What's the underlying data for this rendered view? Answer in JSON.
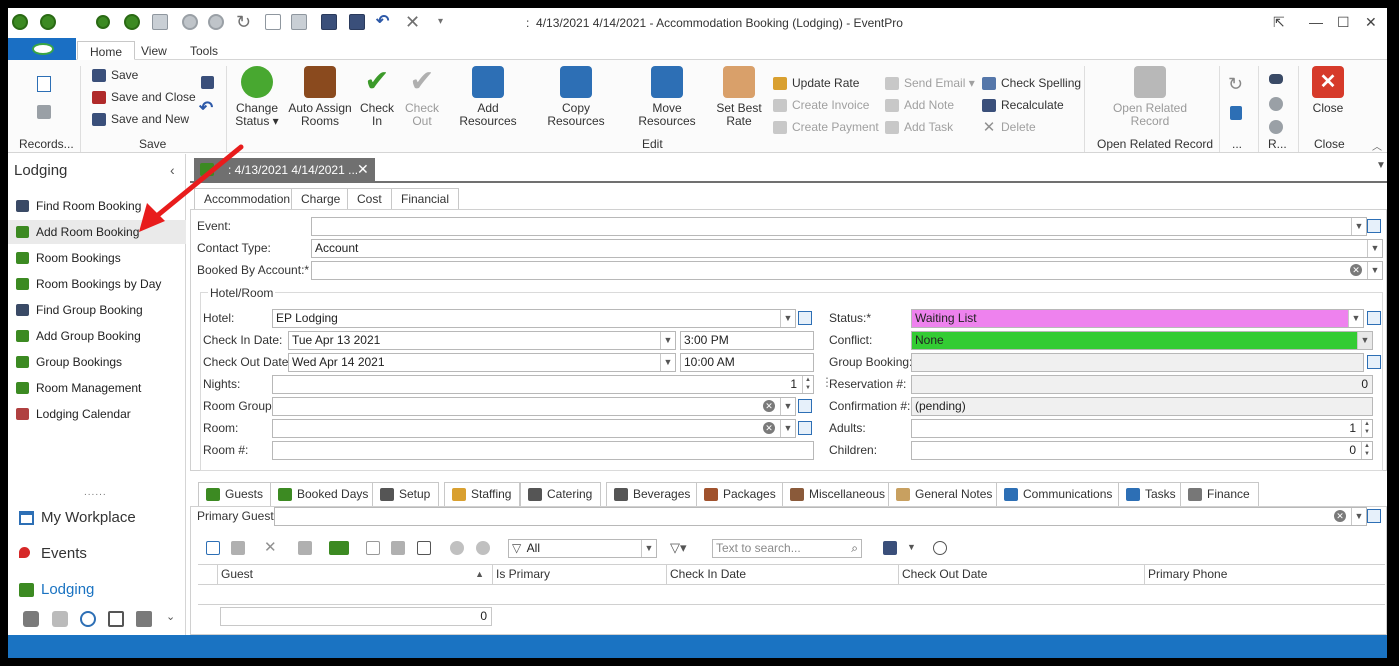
{
  "window": {
    "title": "4/13/2021 4/14/2021  - Accommodation Booking (Lodging) - EventPro",
    "title_prefix": ":"
  },
  "ribbon": {
    "tabs": [
      "Home",
      "View",
      "Tools"
    ],
    "active_tab": "Home",
    "groups": {
      "records": {
        "label": "Records..."
      },
      "save": {
        "label": "Save",
        "save": "Save",
        "save_and_close": "Save and Close",
        "save_and_new": "Save and New"
      },
      "edit": {
        "label": "Edit",
        "change_status": [
          "Change",
          "Status ▾"
        ],
        "auto_assign": [
          "Auto Assign",
          "Rooms"
        ],
        "check_in": [
          "Check",
          "In"
        ],
        "check_out": [
          "Check",
          "Out"
        ],
        "add_resources": "Add Resources",
        "copy_resources": "Copy Resources",
        "move_resources": "Move Resources",
        "set_best_rate": [
          "Set Best",
          "Rate"
        ],
        "update_rate": "Update Rate",
        "create_invoice": "Create Invoice",
        "create_payment": "Create Payment",
        "send_email": "Send Email",
        "add_note": "Add Note",
        "add_task": "Add Task",
        "check_spelling": "Check Spelling",
        "recalculate": "Recalculate",
        "delete": "Delete"
      },
      "open_related": {
        "label": "Open Related Record",
        "button": [
          "Open Related",
          "Record"
        ]
      },
      "misc": {
        "label": "..."
      },
      "r": {
        "label": "R..."
      },
      "close": {
        "label": "Close",
        "button": "Close"
      }
    }
  },
  "sidebar": {
    "title": "Lodging",
    "items": [
      {
        "label": "Find Room Booking",
        "icon": "binoculars-icon",
        "color": "#3a4a66"
      },
      {
        "label": "Add Room Booking",
        "icon": "add-booking-icon",
        "color": "#3c8a22"
      },
      {
        "label": "Room Bookings",
        "icon": "room-bookings-icon",
        "color": "#3c8a22"
      },
      {
        "label": "Room Bookings by Day",
        "icon": "room-bookings-day-icon",
        "color": "#3c8a22"
      },
      {
        "label": "Find Group Booking",
        "icon": "binoculars-icon",
        "color": "#3a4a66"
      },
      {
        "label": "Add Group Booking",
        "icon": "add-group-icon",
        "color": "#3c8a22"
      },
      {
        "label": "Group Bookings",
        "icon": "group-bookings-icon",
        "color": "#3c8a22"
      },
      {
        "label": "Room Management",
        "icon": "room-management-icon",
        "color": "#3c8a22"
      },
      {
        "label": "Lodging Calendar",
        "icon": "calendar-icon",
        "color": "#b04040"
      }
    ],
    "selected_index": 1,
    "grip": "......",
    "nav": [
      {
        "label": "My Workplace",
        "icon": "home-icon"
      },
      {
        "label": "Events",
        "icon": "pin-icon"
      },
      {
        "label": "Lodging",
        "icon": "lodging-icon"
      }
    ],
    "nav_selected": "Lodging"
  },
  "document_tab": {
    "label": ": 4/13/2021 4/14/2021 ..."
  },
  "form_tabs": [
    "Accommodation",
    "Charge",
    "Cost",
    "Financial"
  ],
  "form": {
    "event": {
      "label": "Event:",
      "value": ""
    },
    "contact_type": {
      "label": "Contact Type:",
      "value": "Account"
    },
    "booked_by": {
      "label": "Booked By Account:*",
      "value": ""
    },
    "group_label": "Hotel/Room",
    "hotel": {
      "label": "Hotel:",
      "value": "EP Lodging"
    },
    "check_in_date": {
      "label": "Check In Date:",
      "value": "Tue Apr 13 2021",
      "time": "3:00 PM"
    },
    "check_out_date": {
      "label": "Check Out Date:",
      "value": "Wed Apr 14 2021",
      "time": "10:00 AM"
    },
    "nights": {
      "label": "Nights:",
      "value": "1"
    },
    "room_group": {
      "label": "Room Group:",
      "value": ""
    },
    "room": {
      "label": "Room:",
      "value": ""
    },
    "room_num": {
      "label": "Room #:",
      "value": ""
    },
    "status": {
      "label": "Status:*",
      "value": "Waiting List",
      "color": "#ee82ee"
    },
    "conflict": {
      "label": "Conflict:",
      "value": "None",
      "color": "#33cc33"
    },
    "group_booking": {
      "label": "Group Booking:",
      "value": ""
    },
    "reservation": {
      "label": "Reservation #:",
      "value": "0"
    },
    "confirmation": {
      "label": "Confirmation #:",
      "value": "(pending)"
    },
    "adults": {
      "label": "Adults:",
      "value": "1"
    },
    "children": {
      "label": "Children:",
      "value": "0"
    }
  },
  "bottom_tabs": [
    "Guests",
    "Booked Days",
    "Setup",
    "Staffing",
    "Catering",
    "Beverages",
    "Packages",
    "Miscellaneous",
    "General Notes",
    "Communications",
    "Tasks",
    "Finance"
  ],
  "guests": {
    "primary_guest_label": "Primary Guest:",
    "primary_guest_value": "",
    "filter_value": "All",
    "search_placeholder": "Text to search...",
    "columns": [
      "Guest",
      "Is Primary",
      "Check In Date",
      "Check Out Date",
      "Primary Phone"
    ],
    "footer_count": "0"
  },
  "colors": {
    "accent": "#1a73c2",
    "arrow": "#e81c1c"
  }
}
